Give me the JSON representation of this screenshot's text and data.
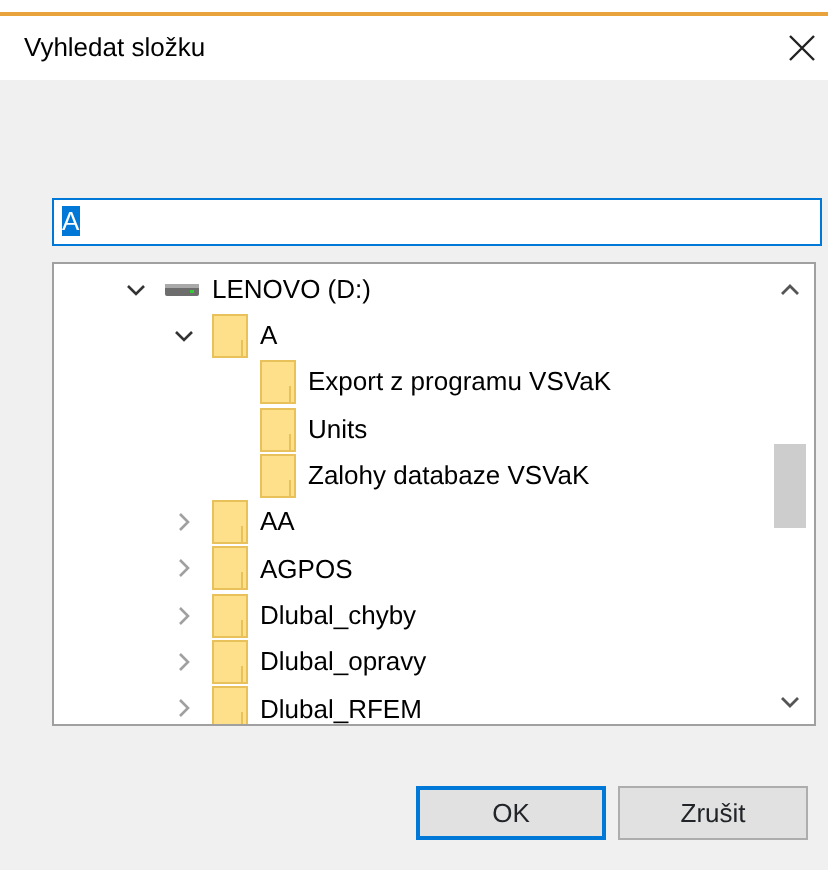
{
  "window": {
    "title": "Vyhledat složku"
  },
  "folder_field": {
    "value": "A",
    "text_selected": true
  },
  "tree": [
    {
      "label": "LENOVO (D:)",
      "kind": "drive",
      "expanded": true,
      "children": [
        {
          "label": "A",
          "kind": "folder",
          "expanded": true,
          "children": [
            {
              "label": "Export z programu VSVaK",
              "kind": "folder"
            },
            {
              "label": "Units",
              "kind": "folder"
            },
            {
              "label": "Zalohy databaze VSVaK",
              "kind": "folder"
            }
          ]
        },
        {
          "label": "AA",
          "kind": "folder",
          "expanded": false
        },
        {
          "label": "AGPOS",
          "kind": "folder",
          "expanded": false
        },
        {
          "label": "Dlubal_chyby",
          "kind": "folder",
          "expanded": false
        },
        {
          "label": "Dlubal_opravy",
          "kind": "folder",
          "expanded": false
        },
        {
          "label": "Dlubal_RFEM",
          "kind": "folder",
          "expanded": false
        }
      ]
    }
  ],
  "buttons": [
    {
      "label": "OK",
      "default": true
    },
    {
      "label": "Zrušit",
      "default": false
    }
  ]
}
